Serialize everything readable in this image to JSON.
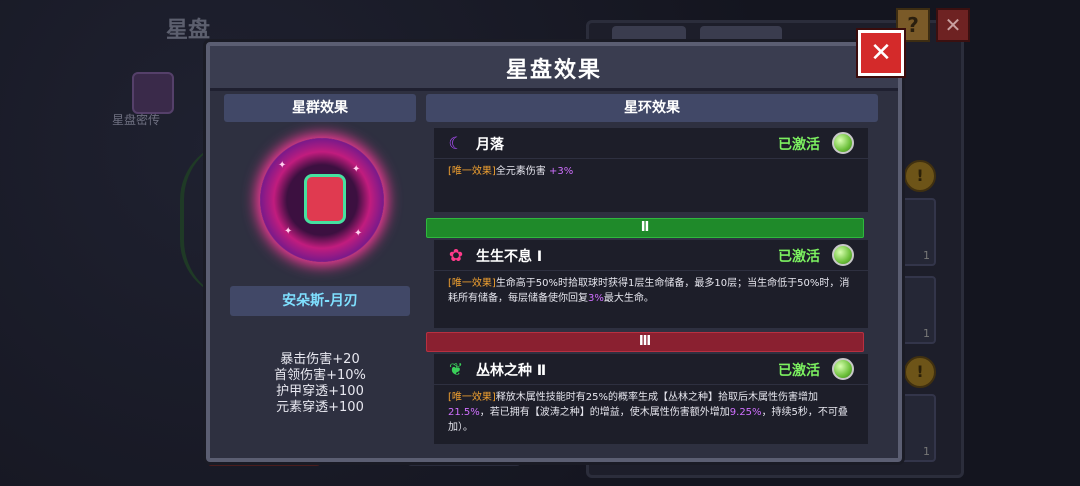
{
  "background": {
    "title": "星盘",
    "icon_label": "星盘密传",
    "help_label": "?",
    "close_label": "✕",
    "slot_counts": [
      "1",
      "1",
      "1"
    ],
    "gold_label": "!"
  },
  "dialog": {
    "title": "星盘效果",
    "close_label": "✕"
  },
  "constellation": {
    "header": "星群效果",
    "emblem_icon": "star-disc-emblem",
    "set_name": "安朵斯-月刃",
    "stats": [
      "暴击伤害+20",
      "首领伤害+10%",
      "护甲穿透+100",
      "元素穿透+100"
    ]
  },
  "rings": {
    "header": "星环效果",
    "tier2_label": "Ⅱ",
    "tier3_label": "Ⅲ",
    "effects": [
      {
        "icon": "crescent-moon-icon",
        "name": "月落",
        "status": "已激活",
        "tag": "[唯一效果]",
        "desc_parts": [
          "全元素伤害 ",
          "+3%"
        ]
      },
      {
        "icon": "flower-icon",
        "name": "生生不息 Ⅰ",
        "status": "已激活",
        "tag": "[唯一效果]",
        "desc_parts": [
          "生命高于50%时拾取球时获得1层生命储备，最多10层；当生命低于50%时，消耗所有储备，每层储备使你回复",
          "3%",
          "最大生命。"
        ]
      },
      {
        "icon": "leaf-icon",
        "name": "丛林之种 Ⅱ",
        "status": "已激活",
        "tag": "[唯一效果]",
        "desc_parts": [
          "释放木属性技能时有25%的概率生成【丛林之种】拾取后木属性伤害增加",
          "21.5%",
          "，若已拥有【波涛之种】的增益，使木属性伤害额外增加",
          "9.25%",
          "，持续5秒，不可叠加）。"
        ]
      }
    ]
  },
  "colors": {
    "accent_green": "#7cf060",
    "accent_orange": "#f0a030",
    "accent_purple": "#d070ff",
    "set_name_cyan": "#7fe0ff",
    "close_red": "#d42a2a"
  }
}
